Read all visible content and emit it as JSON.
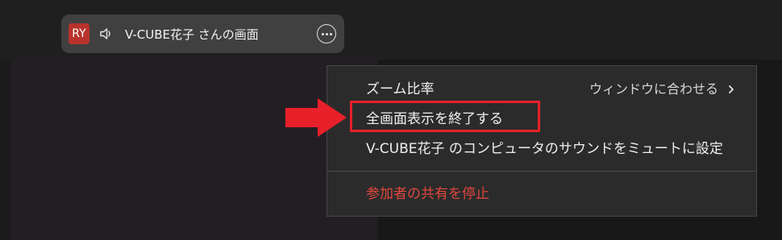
{
  "share_bar": {
    "avatar_initials": "RY",
    "title": "V-CUBE花子 さんの画面",
    "speaker_icon": "speaker-icon",
    "more_icon": "more-options-icon"
  },
  "context_menu": {
    "zoom_label": "ズーム比率",
    "zoom_value": "ウィンドウに合わせる",
    "exit_fullscreen_label": "全画面表示を終了する",
    "mute_computer_sound_label": "V-CUBE花子 のコンピュータのサウンドをミュートに設定",
    "stop_sharing_label": "参加者の共有を停止"
  },
  "annotation": {
    "highlight_color": "#e8202a",
    "arrow_icon": "red-arrow-icon"
  },
  "colors": {
    "avatar_bg": "#b8332c",
    "danger_text": "#e0473d",
    "menu_bg": "#2b2b2b"
  }
}
